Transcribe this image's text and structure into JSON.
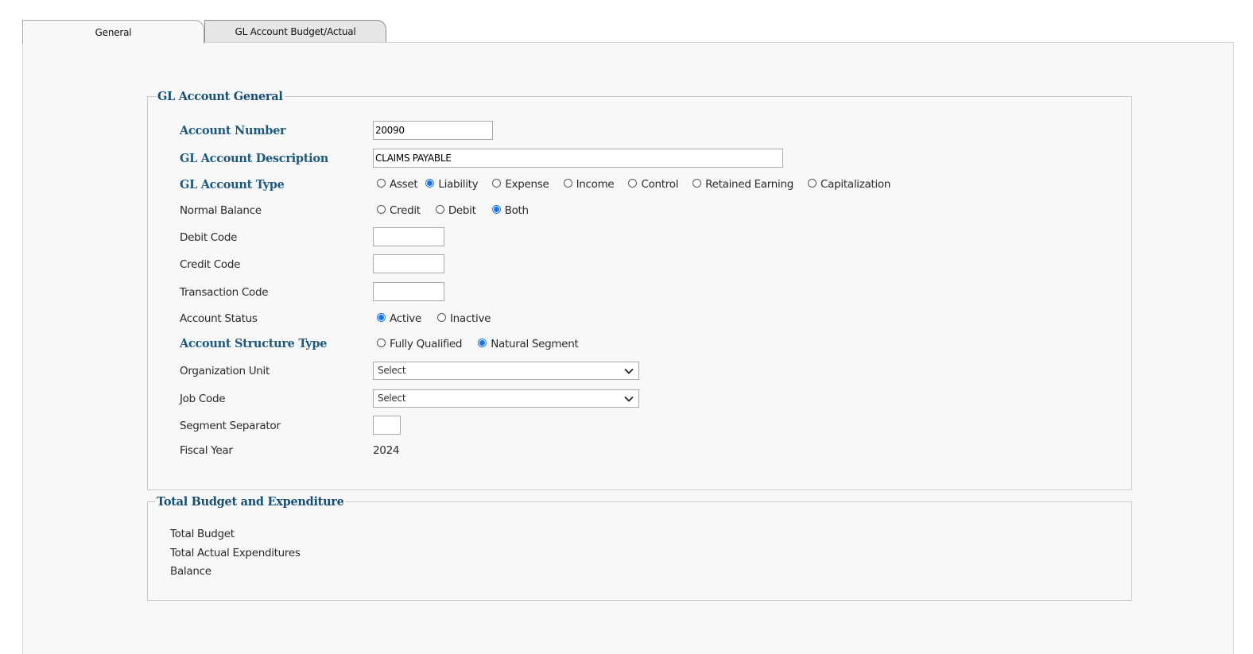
{
  "tabs": [
    {
      "label": "General",
      "active": true
    },
    {
      "label": "GL Account Budget/Actual",
      "active": false
    }
  ],
  "general_section": {
    "legend": "GL Account General",
    "account_number": {
      "label": "Account Number",
      "value": "20090"
    },
    "description": {
      "label": "GL Account Description",
      "value": "CLAIMS PAYABLE"
    },
    "account_type": {
      "label": "GL Account Type",
      "options": [
        "Asset",
        "Liability",
        "Expense",
        "Income",
        "Control",
        "Retained Earning",
        "Capitalization"
      ],
      "selected": "Liability"
    },
    "normal_balance": {
      "label": "Normal Balance",
      "options": [
        "Credit",
        "Debit",
        "Both"
      ],
      "selected": "Both"
    },
    "debit_code": {
      "label": "Debit Code",
      "value": ""
    },
    "credit_code": {
      "label": "Credit Code",
      "value": ""
    },
    "transaction_code": {
      "label": "Transaction Code",
      "value": ""
    },
    "account_status": {
      "label": "Account Status",
      "options": [
        "Active",
        "Inactive"
      ],
      "selected": "Active"
    },
    "structure_type": {
      "label": "Account Structure Type",
      "options": [
        "Fully Qualified",
        "Natural Segment"
      ],
      "selected": "Natural Segment"
    },
    "organization_unit": {
      "label": "Organization Unit",
      "value": "Select"
    },
    "job_code": {
      "label": "Job Code",
      "value": "Select"
    },
    "segment_separator": {
      "label": "Segment Separator",
      "value": ""
    },
    "fiscal_year": {
      "label": "Fiscal Year",
      "value": "2024"
    }
  },
  "budget_section": {
    "legend": "Total Budget and Expenditure",
    "total_budget_label": "Total Budget",
    "total_actual_label": "Total Actual Expenditures",
    "balance_label": "Balance"
  },
  "colors": {
    "accent": "#1a73e8",
    "required_label": "#1e5a7e",
    "legend": "#154f73",
    "panel_bg": "#f8f8f8"
  },
  "icons": {
    "dropdown": "chevron-down-icon"
  }
}
